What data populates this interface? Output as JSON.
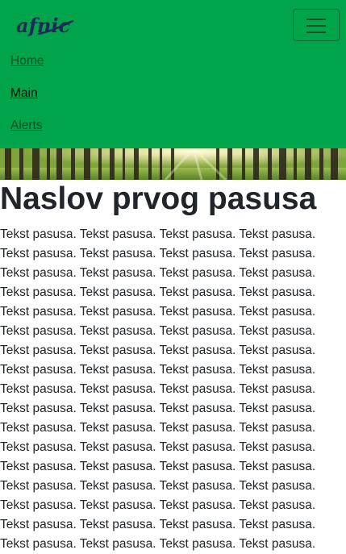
{
  "navbar": {
    "brand_icon": "afnic-logo",
    "brand_text": "afnic",
    "toggler_icon": "hamburger-menu-icon",
    "background_color": "#00a44a",
    "links": [
      {
        "label": "Home"
      },
      {
        "label": "Main"
      },
      {
        "label": "Alerts"
      }
    ]
  },
  "hero": {
    "image": "forest-sunlight-banner"
  },
  "content": {
    "heading": "Naslov prvog pasusa",
    "paragraph": "Tekst pasusa. Tekst pasusa. Tekst pasusa. Tekst pasusa. Tekst pasusa. Tekst pasusa. Tekst pasusa. Tekst pasusa. Tekst pasusa. Tekst pasusa. Tekst pasusa. Tekst pasusa. Tekst pasusa. Tekst pasusa. Tekst pasusa. Tekst pasusa. Tekst pasusa. Tekst pasusa. Tekst pasusa. Tekst pasusa. Tekst pasusa. Tekst pasusa. Tekst pasusa. Tekst pasusa. Tekst pasusa. Tekst pasusa. Tekst pasusa. Tekst pasusa. Tekst pasusa. Tekst pasusa. Tekst pasusa. Tekst pasusa. Tekst pasusa. Tekst pasusa. Tekst pasusa. Tekst pasusa. Tekst pasusa. Tekst pasusa. Tekst pasusa. Tekst pasusa. Tekst pasusa. Tekst pasusa. Tekst pasusa. Tekst pasusa. Tekst pasusa. Tekst pasusa. Tekst pasusa. Tekst pasusa. Tekst pasusa. Tekst pasusa. Tekst pasusa. Tekst pasusa. Tekst pasusa. Tekst pasusa. Tekst pasusa. Tekst pasusa. Tekst pasusa. Tekst pasusa. Tekst pasusa. Tekst pasusa. Tekst pasusa. Tekst pasusa. Tekst pasusa. Tekst pasusa. Tekst pasusa. Tekst pasusa. Tekst pasusa. Tekst pasusa."
  }
}
